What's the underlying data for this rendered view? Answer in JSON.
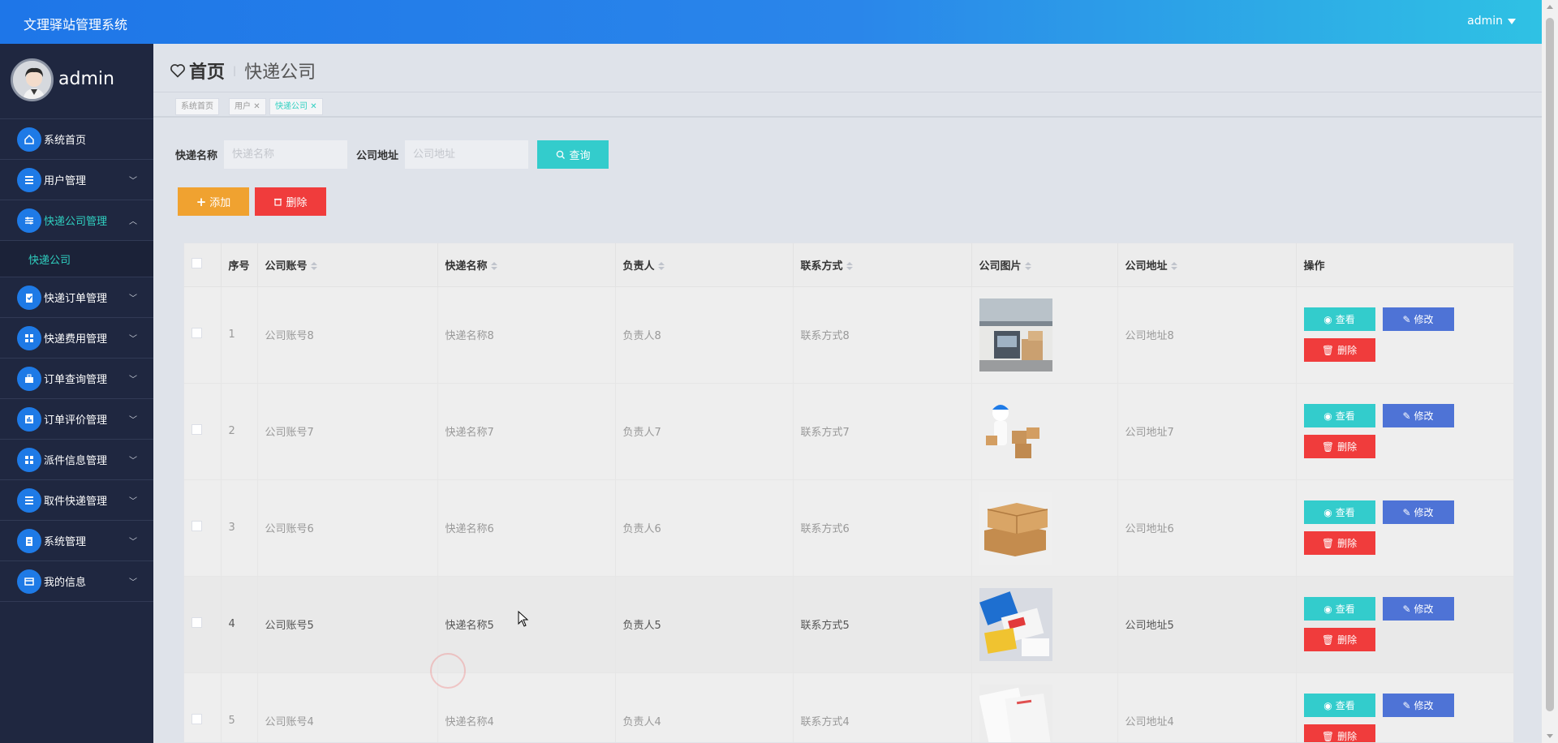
{
  "app": {
    "title": "文理驿站管理系统",
    "user_menu": "admin"
  },
  "sidebar": {
    "username": "admin",
    "items": [
      {
        "label": "系统首页",
        "icon": "home-icon",
        "expandable": false
      },
      {
        "label": "用户管理",
        "icon": "list-icon",
        "expandable": true
      },
      {
        "label": "快递公司管理",
        "icon": "sliders-icon",
        "expandable": true,
        "active": true
      },
      {
        "label": "快递订单管理",
        "icon": "clipboard-icon",
        "expandable": true
      },
      {
        "label": "快递费用管理",
        "icon": "grid-icon",
        "expandable": true
      },
      {
        "label": "订单查询管理",
        "icon": "briefcase-icon",
        "expandable": true
      },
      {
        "label": "订单评价管理",
        "icon": "chart-icon",
        "expandable": true
      },
      {
        "label": "派件信息管理",
        "icon": "grid-icon",
        "expandable": true
      },
      {
        "label": "取件快递管理",
        "icon": "list-icon",
        "expandable": true
      },
      {
        "label": "系统管理",
        "icon": "clipboard-icon",
        "expandable": true
      },
      {
        "label": "我的信息",
        "icon": "card-icon",
        "expandable": true
      }
    ],
    "sub_item": "快递公司"
  },
  "header": {
    "home": "首页",
    "separator": "|",
    "current": "快递公司"
  },
  "tags": [
    {
      "label": "系统首页",
      "closable": false
    },
    {
      "label": "用户",
      "closable": true
    },
    {
      "label": "快递公司",
      "closable": true,
      "active": true
    }
  ],
  "search": {
    "name_label": "快递名称",
    "name_placeholder": "快递名称",
    "addr_label": "公司地址",
    "addr_placeholder": "公司地址",
    "query_label": "查询"
  },
  "actions": {
    "add_label": "添加",
    "delete_label": "删除"
  },
  "table": {
    "columns": [
      "序号",
      "公司账号",
      "快递名称",
      "负责人",
      "联系方式",
      "公司图片",
      "公司地址",
      "操作"
    ],
    "rows": [
      {
        "no": "1",
        "account": "公司账号8",
        "name": "快递名称8",
        "manager": "负责人8",
        "contact": "联系方式8",
        "image": "truck-warehouse",
        "address": "公司地址8"
      },
      {
        "no": "2",
        "account": "公司账号7",
        "name": "快递名称7",
        "manager": "负责人7",
        "contact": "联系方式7",
        "image": "courier-boxes",
        "address": "公司地址7"
      },
      {
        "no": "3",
        "account": "公司账号6",
        "name": "快递名称6",
        "manager": "负责人6",
        "contact": "联系方式6",
        "image": "cardboard-boxes",
        "address": "公司地址6"
      },
      {
        "no": "4",
        "account": "公司账号5",
        "name": "快递名称5",
        "manager": "负责人5",
        "contact": "联系方式5",
        "image": "envelopes",
        "address": "公司地址5"
      },
      {
        "no": "5",
        "account": "公司账号4",
        "name": "快递名称4",
        "manager": "负责人4",
        "contact": "联系方式4",
        "image": "paper-bags",
        "address": "公司地址4"
      }
    ],
    "op_view": "查看",
    "op_edit": "修改",
    "op_delete": "删除"
  },
  "colors": {
    "primary": "#1e76e8",
    "teal": "#33cccc",
    "orange": "#f0a230",
    "red": "#f03c3c",
    "edit_blue": "#4e73d6",
    "sidebar_bg": "#1f2740"
  }
}
